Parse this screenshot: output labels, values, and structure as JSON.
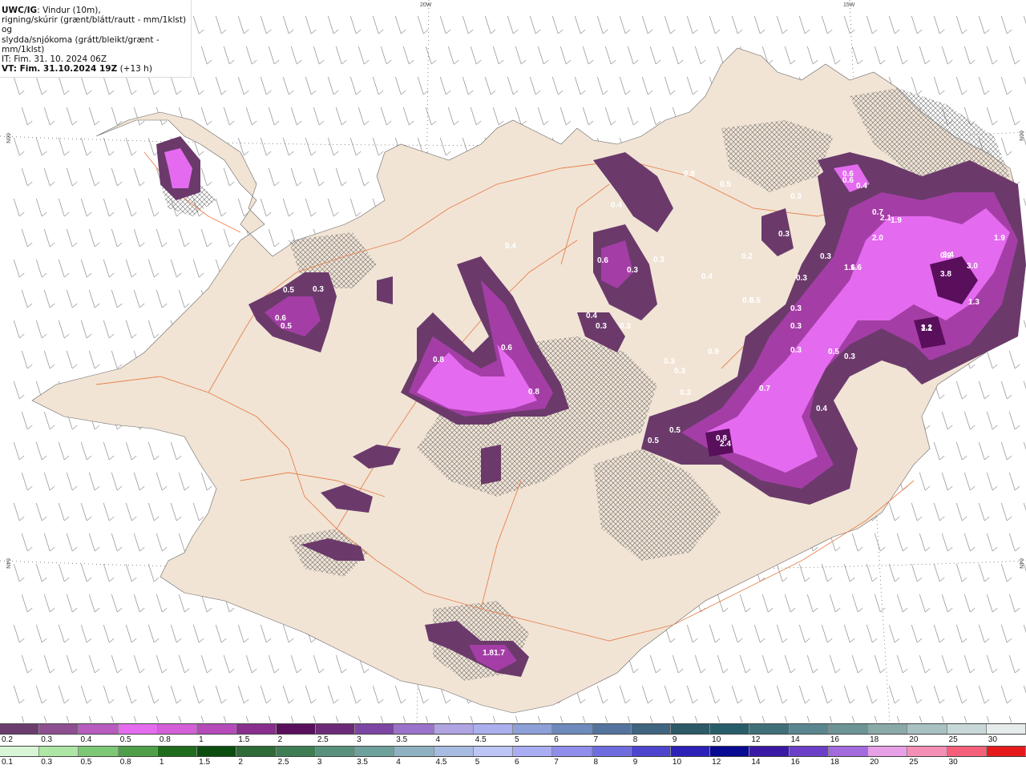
{
  "header": {
    "model": "UWC/IG",
    "line1": ": Vindur (10m),",
    "line2": "rigning/skúrir (grænt/blátt/rautt - mm/1klst) og",
    "line3": "slydda/snjókoma (grátt/bleikt/grænt - mm/1klst)",
    "it": "IT: Fim. 31. 10. 2024 06Z",
    "vt_bold": "VT: Fim. 31.10.2024 19Z",
    "vt_rest": " (+13 h)"
  },
  "grid_labels": {
    "top": [
      "20W",
      "15W"
    ],
    "left": [
      "66N",
      "64N"
    ],
    "right": [
      "66N",
      "64N"
    ]
  },
  "colors": {
    "land": "#f1e4d5",
    "sea": "#ffffff",
    "roads": "#e8814d",
    "wind_barb": "#9a9a9a",
    "precip_dark": "#6b3a6b",
    "precip_mid": "#a43ea6",
    "precip_light": "#e46bef"
  },
  "precip_labels": [
    "0.3",
    "0.4",
    "0.5",
    "0.5",
    "0.6",
    "0.7",
    "0.8",
    "0.9",
    "1.1",
    "1.3",
    "1.6",
    "1.9",
    "2.0",
    "2.1",
    "2.4",
    "3.0",
    "3.2",
    "3.4",
    "3.8",
    "1.81.7",
    "0.2",
    "0.6",
    "0.4",
    "0.3",
    "0.3",
    "0.5",
    "0.7",
    "0.5",
    "0.3",
    "0.8",
    "0.5",
    "0.3",
    "0.4",
    "0.3",
    "0.5",
    "0.3",
    "0.9",
    "0.3",
    "0.3",
    "0.3",
    "0.4",
    "0.3",
    "0.3",
    "0.4",
    "0.6",
    "0.3",
    "0.3",
    "0.2",
    "1.6",
    "1.9",
    "0.3",
    "0.4",
    "0.5",
    "0.6",
    "0.3",
    "0.5",
    "0.8",
    "0.8",
    "0.6"
  ],
  "colorbar_snow": {
    "labels": [
      "0.2",
      "0.3",
      "0.4",
      "0.5",
      "0.8",
      "1",
      "1.5",
      "2",
      "2.5",
      "3",
      "3.5",
      "4",
      "4.5",
      "5",
      "6",
      "7",
      "8",
      "9",
      "10",
      "12",
      "14",
      "16",
      "18",
      "20",
      "25",
      "30"
    ],
    "colors": [
      "#6b3d6e",
      "#8e4f91",
      "#b95cbf",
      "#e56cee",
      "#d45fd9",
      "#b44bb9",
      "#8a2e8e",
      "#5a0f5d",
      "#6c2a78",
      "#7e46a4",
      "#9b73cc",
      "#b0a4e3",
      "#aab0ee",
      "#8da0d8",
      "#6f8bbd",
      "#54749f",
      "#3f6580",
      "#2c5a66",
      "#285d6a",
      "#3f7079",
      "#5a878f",
      "#6d9596",
      "#8aaaa8",
      "#a8c2c2",
      "#c8d8d8",
      "#e6ecec"
    ]
  },
  "colorbar_rain": {
    "labels": [
      "0.1",
      "0.3",
      "0.5",
      "0.8",
      "1",
      "1.5",
      "2",
      "2.5",
      "3",
      "3.5",
      "4",
      "4.5",
      "5",
      "6",
      "7",
      "8",
      "9",
      "10",
      "12",
      "14",
      "16",
      "18",
      "20",
      "25",
      "30"
    ],
    "colors": [
      "#d8f5d5",
      "#aee6a5",
      "#7dc874",
      "#4f9f49",
      "#1f6c1c",
      "#0b4d0e",
      "#2e6b36",
      "#3f7e55",
      "#5a917c",
      "#6ea19c",
      "#8fb2c2",
      "#a8bbe0",
      "#bcc5f4",
      "#a9aef2",
      "#8f8feb",
      "#6f6ce0",
      "#4e45cf",
      "#2c22b8",
      "#080a92",
      "#3a1aa4",
      "#6b3fc7",
      "#a46bdf",
      "#e7a0e6",
      "#f58fb5",
      "#f4607a",
      "#e61a1a"
    ]
  }
}
